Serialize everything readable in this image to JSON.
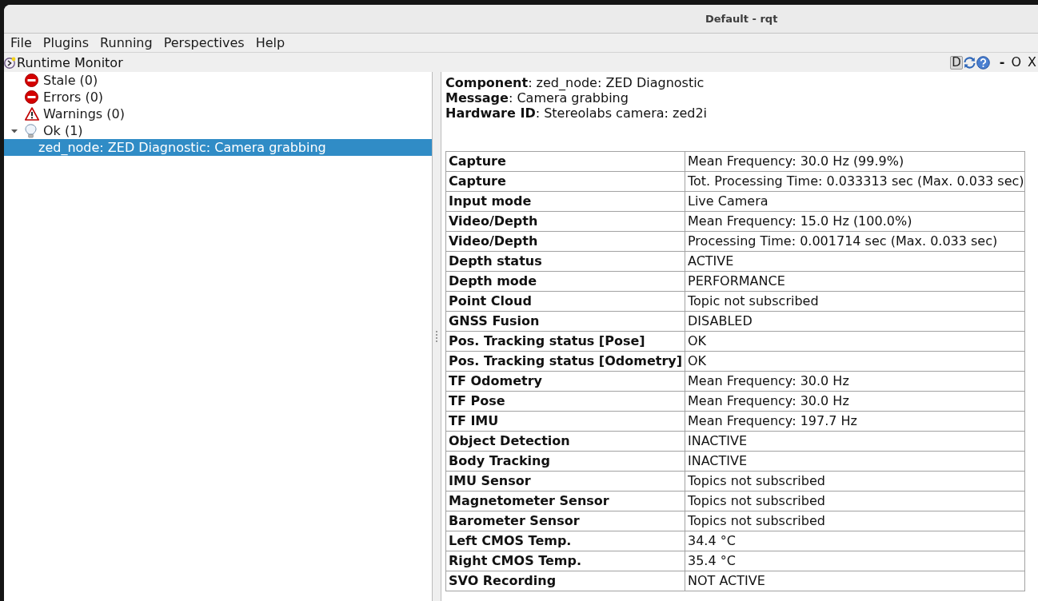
{
  "window": {
    "title": "Default - rqt"
  },
  "menu": [
    "File",
    "Plugins",
    "Running",
    "Perspectives",
    "Help"
  ],
  "dock": {
    "title": "Runtime Monitor",
    "tools": [
      {
        "kind": "text",
        "label": "D"
      },
      {
        "kind": "refresh"
      },
      {
        "kind": "help"
      }
    ],
    "window_buttons": [
      "-",
      "O",
      "X"
    ]
  },
  "tree": [
    {
      "label": "Stale (0)",
      "kind": "stale",
      "selected": false
    },
    {
      "label": "Errors (0)",
      "kind": "error",
      "selected": false
    },
    {
      "label": "Warnings (0)",
      "kind": "warning",
      "selected": false
    },
    {
      "label": "Ok (1)",
      "kind": "ok",
      "selected": false,
      "expanded": true,
      "children": [
        {
          "label": "zed_node: ZED Diagnostic: Camera grabbing",
          "selected": true
        }
      ]
    }
  ],
  "details": {
    "lines": [
      "**Component**: zed_node: ZED Diagnostic",
      "**Message**: Camera grabbing",
      "**Hardware ID**: Stereolabs camera: zed2i"
    ],
    "table": [
      {
        "key": "Capture",
        "value": "Mean Frequency: 30.0 Hz (99.9%)"
      },
      {
        "key": "Capture",
        "value": "Tot. Processing Time: 0.033313 sec (Max. 0.033 sec)"
      },
      {
        "key": "Input mode",
        "value": "Live Camera"
      },
      {
        "key": "Video/Depth",
        "value": "Mean Frequency: 15.0 Hz (100.0%)"
      },
      {
        "key": "Video/Depth",
        "value": "Processing Time: 0.001714 sec (Max. 0.033 sec)"
      },
      {
        "key": "Depth status",
        "value": "ACTIVE"
      },
      {
        "key": "Depth mode",
        "value": "PERFORMANCE"
      },
      {
        "key": "Point Cloud",
        "value": "Topic not subscribed"
      },
      {
        "key": "GNSS Fusion",
        "value": "DISABLED"
      },
      {
        "key": "Pos. Tracking status [Pose]",
        "value": "OK"
      },
      {
        "key": "Pos. Tracking status [Odometry]",
        "value": "OK"
      },
      {
        "key": "TF Odometry",
        "value": "Mean Frequency: 30.0 Hz"
      },
      {
        "key": "TF Pose",
        "value": "Mean Frequency: 30.0 Hz"
      },
      {
        "key": "TF IMU",
        "value": "Mean Frequency: 197.7 Hz"
      },
      {
        "key": "Object Detection",
        "value": "INACTIVE"
      },
      {
        "key": "Body Tracking",
        "value": "INACTIVE"
      },
      {
        "key": "IMU Sensor",
        "value": "Topics not subscribed"
      },
      {
        "key": "Magnetometer Sensor",
        "value": "Topics not subscribed"
      },
      {
        "key": "Barometer Sensor",
        "value": "Topics not subscribed"
      },
      {
        "key": "Left CMOS Temp.",
        "value": "34.4 °C"
      },
      {
        "key": "Right CMOS Temp.",
        "value": "35.4 °C"
      },
      {
        "key": "SVO Recording",
        "value": "NOT ACTIVE"
      }
    ]
  }
}
